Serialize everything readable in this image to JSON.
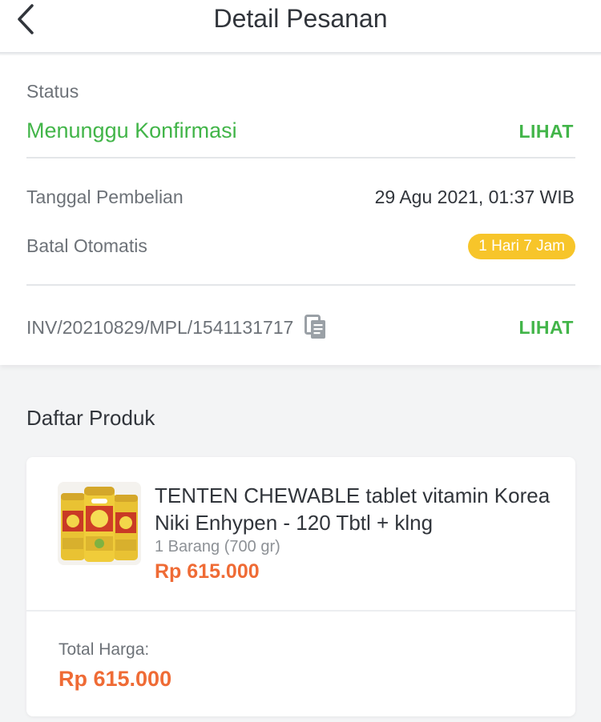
{
  "header": {
    "title": "Detail Pesanan",
    "back_icon": "chevron-left-icon"
  },
  "status": {
    "label": "Status",
    "value": "Menunggu Konfirmasi",
    "value_color": "#42b549",
    "link": "LIHAT"
  },
  "purchase": {
    "date_label": "Tanggal Pembelian",
    "date_value": "29 Agu 2021, 01:37 WIB",
    "auto_cancel_label": "Batal Otomatis",
    "auto_cancel_badge": "1 Hari 7 Jam",
    "badge_color": "#f7c52a"
  },
  "invoice": {
    "number": "INV/20210829/MPL/1541131717",
    "copy_icon": "copy-icon",
    "link": "LIHAT"
  },
  "products": {
    "section_title": "Daftar Produk",
    "items": [
      {
        "name": "TENTEN CHEWABLE tablet vitamin Korea Niki Enhypen - 120 Tbtl + klng",
        "quantity": "1 Barang (700 gr)",
        "price": "Rp 615.000"
      }
    ],
    "total_label": "Total Harga:",
    "total_value": "Rp 615.000",
    "price_color": "#ef6b35"
  }
}
